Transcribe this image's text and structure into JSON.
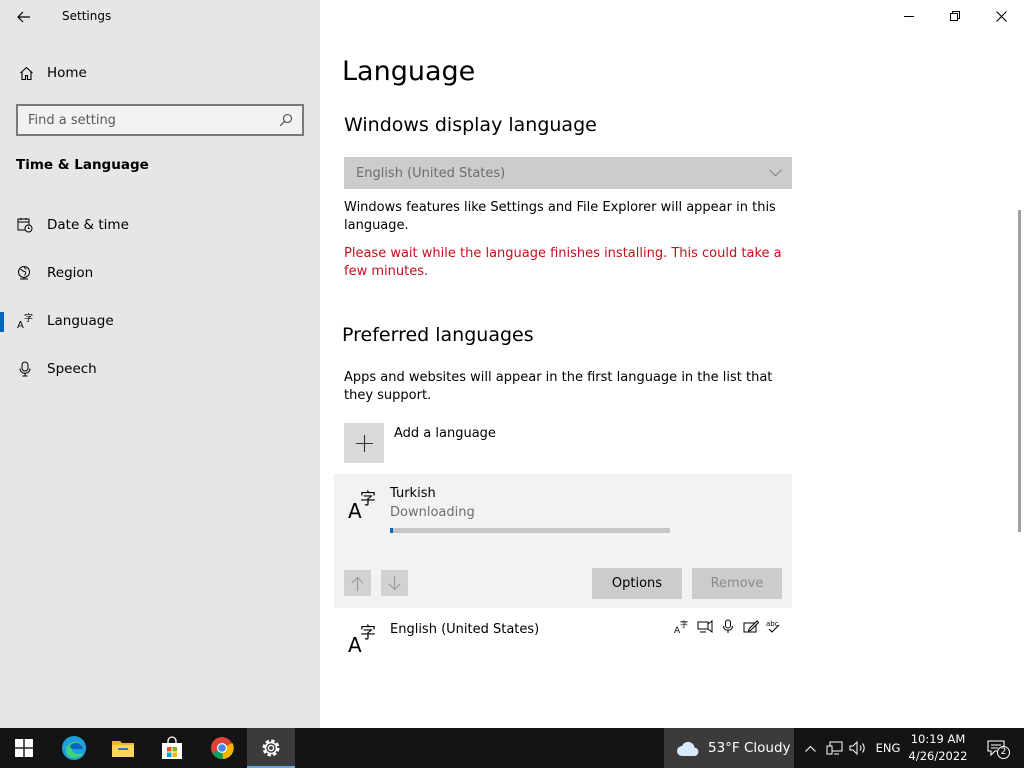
{
  "window": {
    "app_title": "Settings"
  },
  "sidebar": {
    "home_label": "Home",
    "search": {
      "placeholder": "Find a setting"
    },
    "section_title": "Time & Language",
    "items": [
      {
        "label": "Date & time",
        "icon": "calendar-clock-icon"
      },
      {
        "label": "Region",
        "icon": "globe-icon"
      },
      {
        "label": "Language",
        "icon": "language-icon",
        "active": true
      },
      {
        "label": "Speech",
        "icon": "microphone-icon"
      }
    ]
  },
  "main": {
    "title": "Language",
    "display_language": {
      "heading": "Windows display language",
      "selected": "English (United States)",
      "description": "Windows features like Settings and File Explorer will appear in this language.",
      "warning": "Please wait while the language finishes installing. This could take a few minutes."
    },
    "preferred": {
      "heading": "Preferred languages",
      "description": "Apps and websites will appear in the first language in the list that they support.",
      "add_label": "Add a language",
      "languages": [
        {
          "name": "Turkish",
          "status": "Downloading",
          "progress": 0.01,
          "options_label": "Options",
          "remove_label": "Remove"
        },
        {
          "name": "English (United States)",
          "features": [
            "display-language-icon",
            "text-to-speech-icon",
            "speech-icon",
            "handwriting-icon",
            "spellcheck-icon"
          ]
        }
      ]
    }
  },
  "taskbar": {
    "apps": [
      "start-icon",
      "edge-icon",
      "file-explorer-icon",
      "store-icon",
      "chrome-icon",
      "settings-icon"
    ],
    "weather": {
      "text": "53°F  Cloudy"
    },
    "input_language": "ENG",
    "time": "10:19 AM",
    "date": "4/26/2022",
    "notification_count": "2"
  },
  "colors": {
    "accent": "#0067c0",
    "warning": "#c50f1f",
    "sidebar_bg": "#e6e6e6",
    "taskbar_bg": "#141414"
  }
}
